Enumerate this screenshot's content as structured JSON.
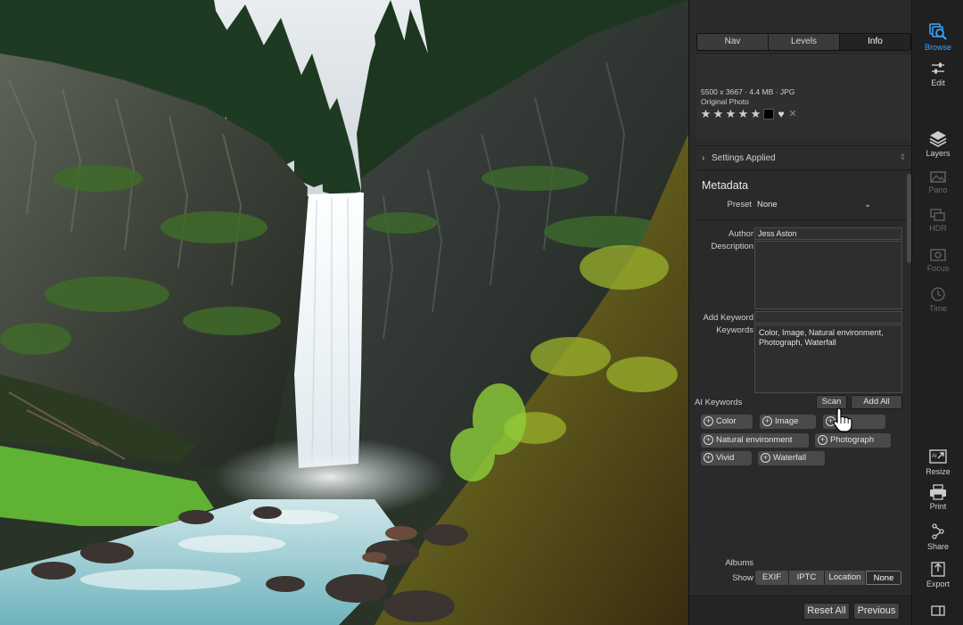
{
  "panel": {
    "tabs": [
      {
        "label": "Nav",
        "active": false
      },
      {
        "label": "Levels",
        "active": false
      },
      {
        "label": "Info",
        "active": true
      }
    ],
    "info": {
      "dimensions": "5500 x 3667 · 4.4 MB · JPG",
      "subtitle": "Original Photo",
      "rating": 5,
      "color_label": "#000000"
    },
    "settings_applied": "Settings Applied",
    "metadata": {
      "title": "Metadata",
      "preset_label": "Preset",
      "preset_value": "None",
      "author_label": "Author",
      "author_value": "Jess Aston",
      "description_label": "Description",
      "description_value": "",
      "add_keyword_label": "Add Keyword",
      "add_keyword_value": "",
      "keywords_label": "Keywords",
      "keywords_value": "Color, Image, Natural environment, Photograph, Waterfall"
    },
    "ai_keywords": {
      "label": "AI Keywords",
      "scan_label": "Scan",
      "add_all_label": "Add All",
      "chips": [
        "Color",
        "Image",
        "Sky",
        "Natural environment",
        "Photograph",
        "Vivid",
        "Waterfall"
      ]
    },
    "albums_label": "Albums",
    "show": {
      "label": "Show",
      "options": [
        "EXIF",
        "IPTC",
        "Location",
        "None"
      ],
      "selected": "None"
    },
    "footer": {
      "reset_all": "Reset All",
      "previous": "Previous"
    }
  },
  "toolbar": {
    "accent": "#3aa4ff",
    "items": [
      {
        "label": "Browse",
        "icon": "browse-icon",
        "state": "active"
      },
      {
        "label": "Edit",
        "icon": "edit-sliders-icon",
        "state": "normal"
      },
      {
        "label": "Layers",
        "icon": "layers-icon",
        "state": "normal"
      },
      {
        "label": "Pano",
        "icon": "pano-icon",
        "state": "disabled"
      },
      {
        "label": "HDR",
        "icon": "hdr-icon",
        "state": "disabled"
      },
      {
        "label": "Focus",
        "icon": "focus-icon",
        "state": "disabled"
      },
      {
        "label": "Time",
        "icon": "time-icon",
        "state": "disabled"
      },
      {
        "label": "Resize",
        "icon": "resize-icon",
        "state": "normal"
      },
      {
        "label": "Print",
        "icon": "print-icon",
        "state": "normal"
      },
      {
        "label": "Share",
        "icon": "share-icon",
        "state": "normal"
      },
      {
        "label": "Export",
        "icon": "export-icon",
        "state": "normal"
      }
    ]
  }
}
